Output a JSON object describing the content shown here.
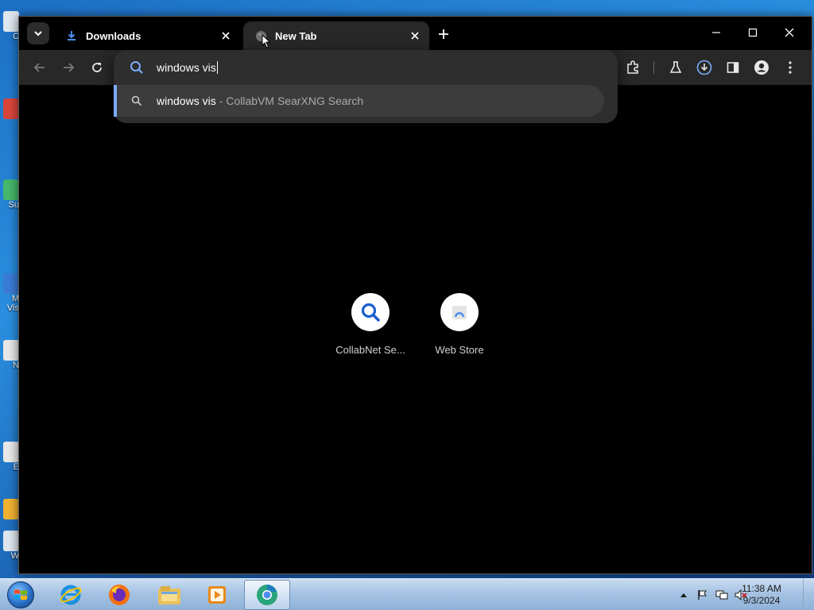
{
  "desktop": {
    "icons": [
      {
        "label": "C"
      },
      {
        "label": ""
      },
      {
        "label": "Su"
      },
      {
        "label": "M\nVis"
      },
      {
        "label": "N"
      },
      {
        "label": "E"
      },
      {
        "label": ""
      },
      {
        "label": "W"
      }
    ]
  },
  "browser": {
    "tabs": [
      {
        "title": "Downloads",
        "icon": "download-icon",
        "active": false
      },
      {
        "title": "New Tab",
        "icon": "globe-icon",
        "active": true
      }
    ],
    "omnibox": {
      "value": "windows vis",
      "suggestion": {
        "query": "windows vis",
        "separator": "-",
        "source": "CollabVM SearXNG Search"
      }
    },
    "shortcuts": [
      {
        "label": "CollabNet Se...",
        "icon": "search-icon"
      },
      {
        "label": "Web Store",
        "icon": "web-store-icon"
      }
    ],
    "colors": {
      "accent": "#7cacf8",
      "toolbar": "#282828",
      "omnibox": "#2e2e2e",
      "page_background": "#000000"
    }
  },
  "taskbar": {
    "apps": [
      {
        "name": "internet-explorer-icon"
      },
      {
        "name": "firefox-icon"
      },
      {
        "name": "file-explorer-icon"
      },
      {
        "name": "media-player-icon"
      },
      {
        "name": "chromium-icon",
        "active": true
      }
    ],
    "clock": {
      "time": "11:38 AM",
      "date": "9/3/2024"
    }
  }
}
